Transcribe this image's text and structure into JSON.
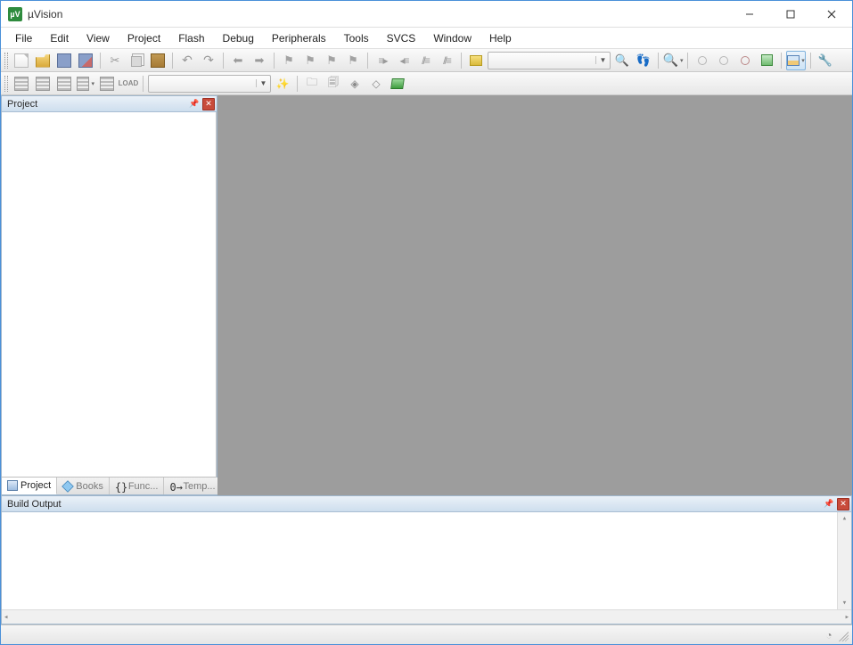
{
  "title": "µVision",
  "menu": [
    "File",
    "Edit",
    "View",
    "Project",
    "Flash",
    "Debug",
    "Peripherals",
    "Tools",
    "SVCS",
    "Window",
    "Help"
  ],
  "toolbar1": {
    "combo_find": ""
  },
  "toolbar2": {
    "target_combo": "",
    "load_label": "LOAD"
  },
  "panels": {
    "project_title": "Project",
    "build_title": "Build Output"
  },
  "project_tabs": {
    "project": "Project",
    "books": "Books",
    "functions": "Func...",
    "templates": "Temp..."
  },
  "build_output": ""
}
